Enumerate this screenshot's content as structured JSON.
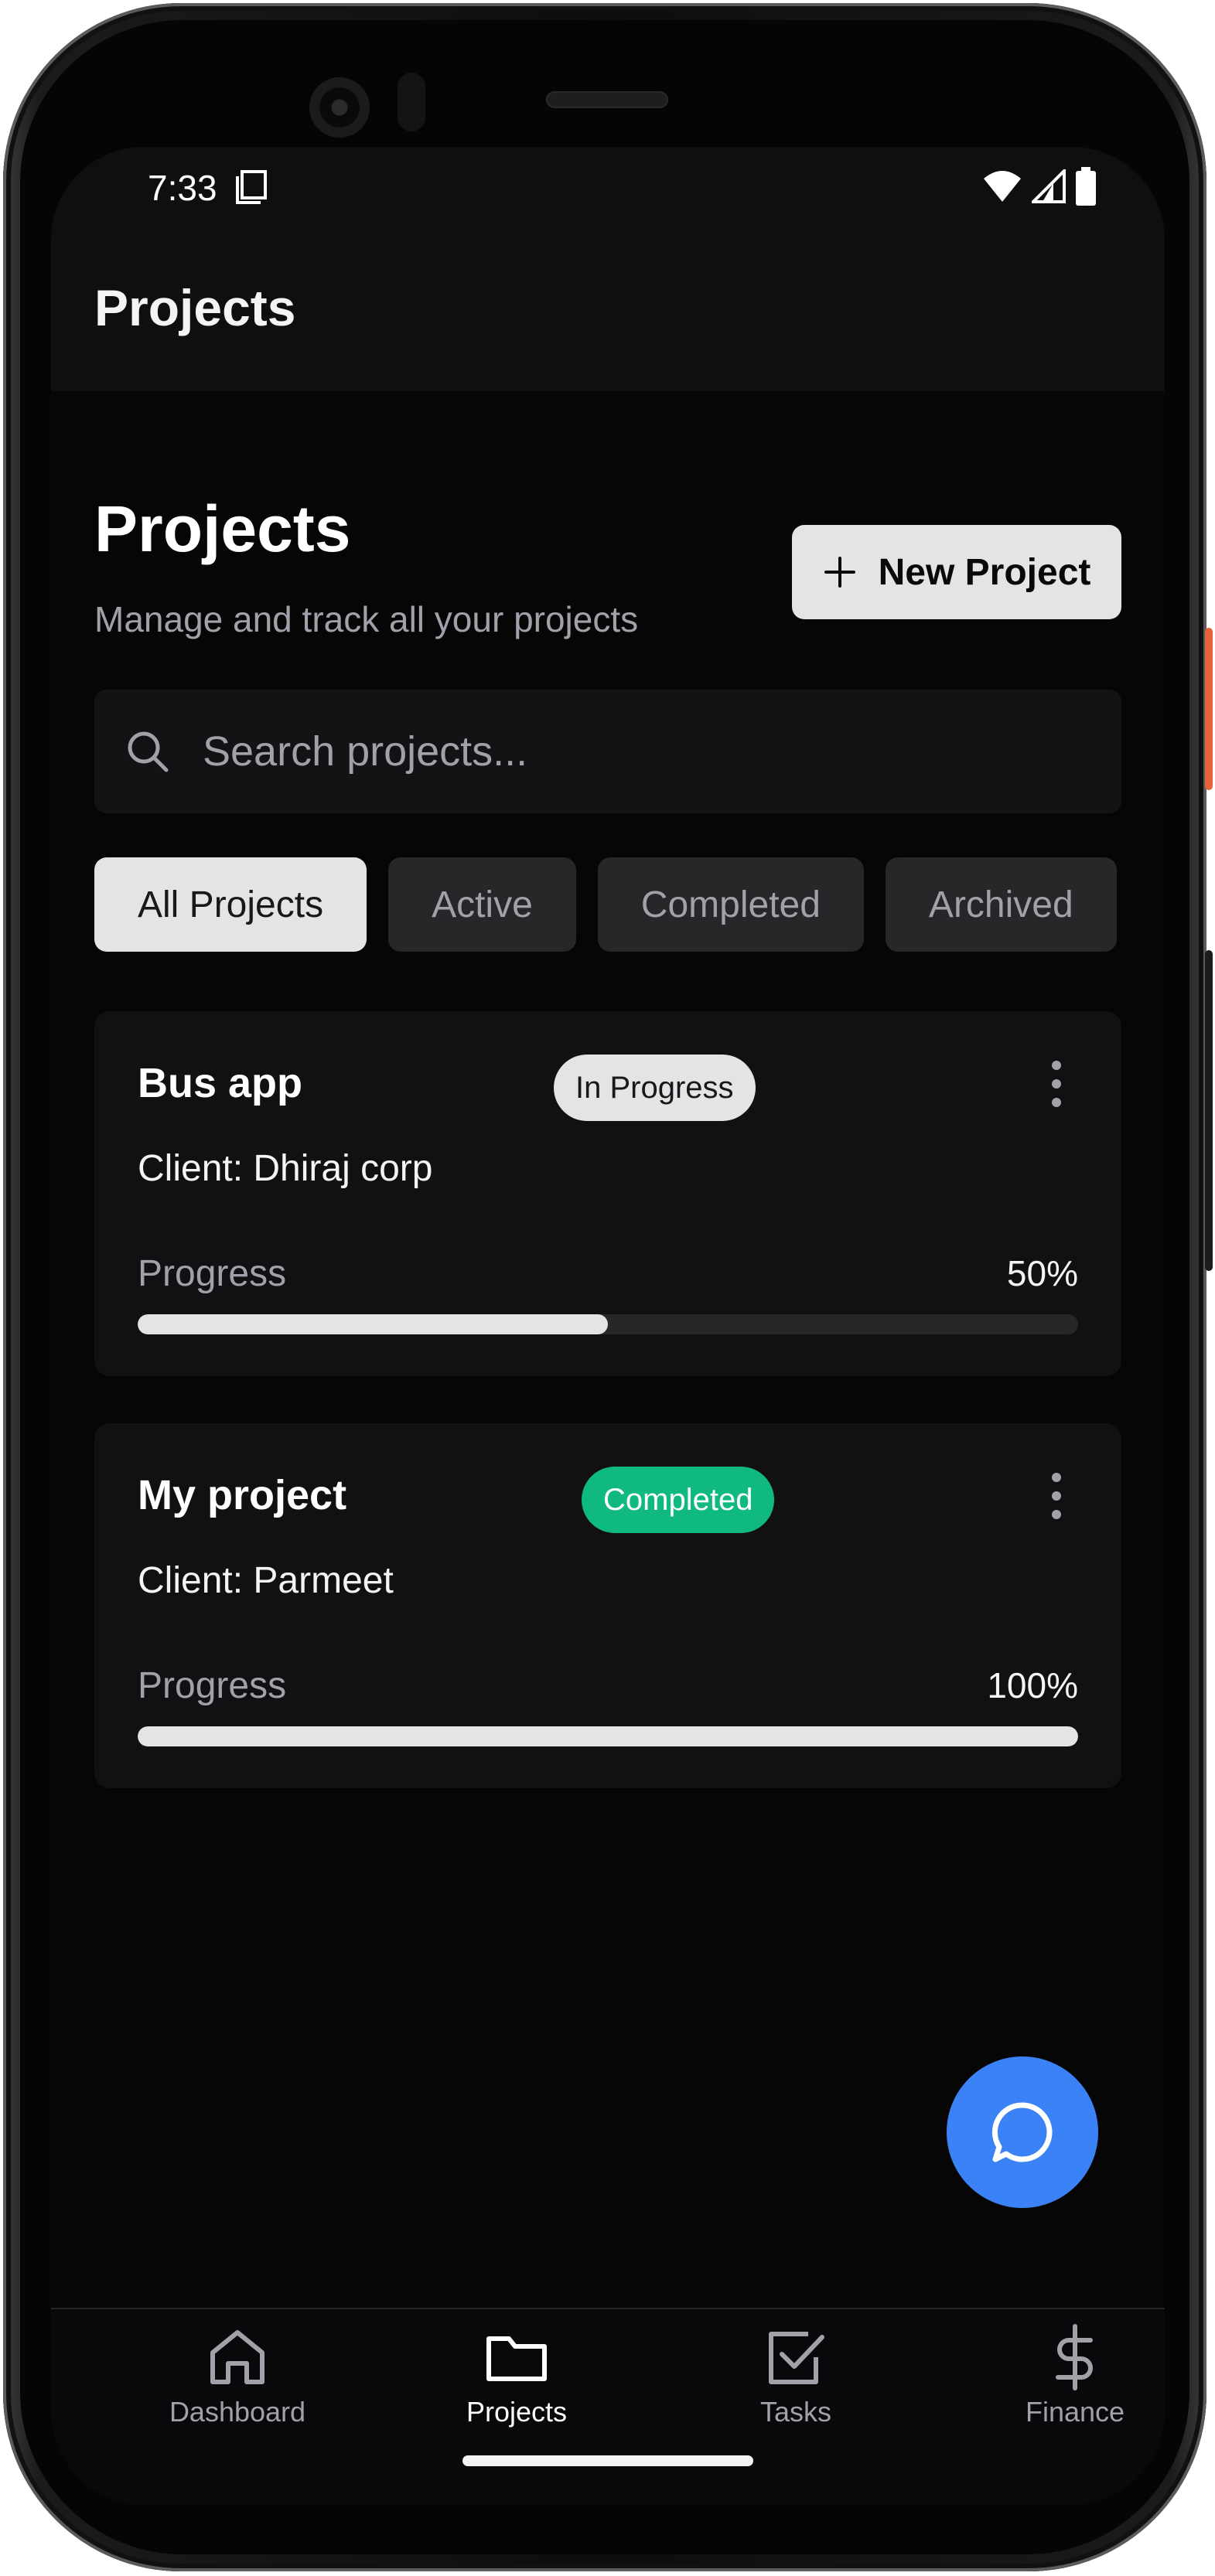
{
  "status": {
    "time": "7:33"
  },
  "appbar": {
    "title": "Projects"
  },
  "header": {
    "title": "Projects",
    "subtitle": "Manage and track all your projects",
    "new_button": "New Project"
  },
  "search": {
    "placeholder": "Search projects..."
  },
  "filters": [
    {
      "label": "All Projects",
      "active": true
    },
    {
      "label": "Active",
      "active": false
    },
    {
      "label": "Completed",
      "active": false
    },
    {
      "label": "Archived",
      "active": false
    }
  ],
  "projects": [
    {
      "name": "Bus app",
      "status": "In Progress",
      "client": "Client: Dhiraj corp",
      "progress_label": "Progress",
      "progress_text": "50%",
      "progress": 0.5
    },
    {
      "name": "My project",
      "status": "Completed",
      "client": "Client: Parmeet",
      "progress_label": "Progress",
      "progress_text": "100%",
      "progress": 1.0
    }
  ],
  "nav": [
    {
      "label": "Dashboard",
      "icon": "home-icon",
      "active": false
    },
    {
      "label": "Projects",
      "icon": "folder-icon",
      "active": true
    },
    {
      "label": "Tasks",
      "icon": "checkbox-icon",
      "active": false
    },
    {
      "label": "Finance",
      "icon": "dollar-icon",
      "active": false
    }
  ],
  "colors": {
    "accent": "#3b82f6",
    "completed": "#10b981",
    "background": "#060607"
  }
}
